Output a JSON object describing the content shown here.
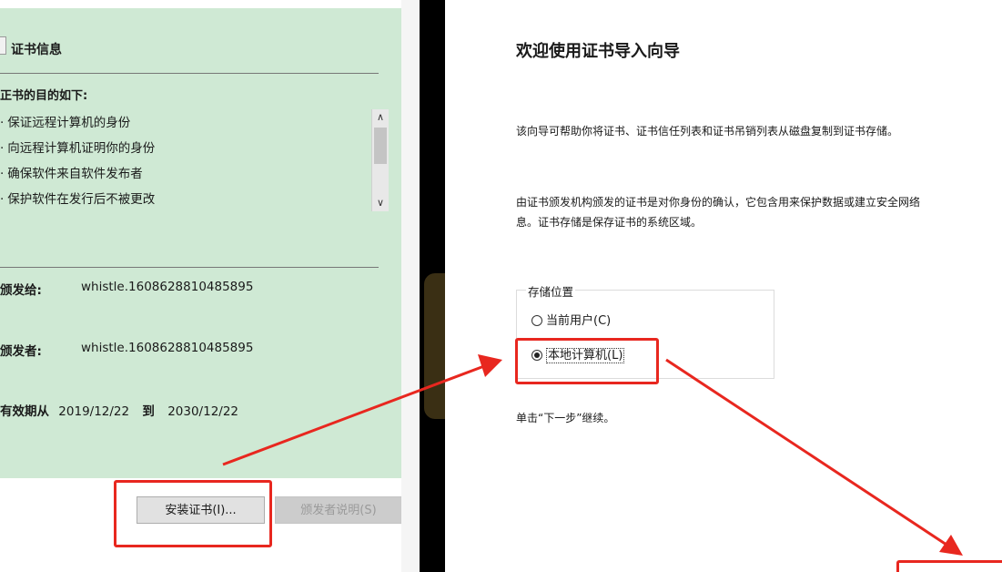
{
  "left_dialog": {
    "section_title": "证书信息",
    "purpose_heading": "正书的目的如下:",
    "purposes": [
      "保证远程计算机的身份",
      "向远程计算机证明你的身份",
      "确保软件来自软件发布者",
      "保护软件在发行后不被更改"
    ],
    "issued_to_label": "颁发给:",
    "issued_to_value": "whistle.1608628810485895",
    "issued_by_label": "颁发者:",
    "issued_by_value": "whistle.1608628810485895",
    "validity_label": "有效期从",
    "valid_from": "2019/12/22",
    "validity_to": "到",
    "valid_to": "2030/12/22",
    "install_button": "安装证书(I)...",
    "issuer_statement_button": "颁发者说明(S)",
    "panel_color": "#cfe9d4"
  },
  "wizard": {
    "title": "欢迎使用证书导入向导",
    "intro": "该向导可帮助你将证书、证书信任列表和证书吊销列表从磁盘复制到证书存储。",
    "description_line1": "由证书颁发机构颁发的证书是对你身份的确认，它包含用来保护数据或建立安全网络",
    "description_line2": "息。证书存储是保存证书的系统区域。",
    "store_location_legend": "存储位置",
    "options": [
      {
        "label": "当前用户(C)",
        "selected": false
      },
      {
        "label": "本地计算机(L)",
        "selected": true
      }
    ],
    "next_hint": "单击“下一步”继续。"
  },
  "annotations": {
    "highlight_color": "#e8271f"
  }
}
